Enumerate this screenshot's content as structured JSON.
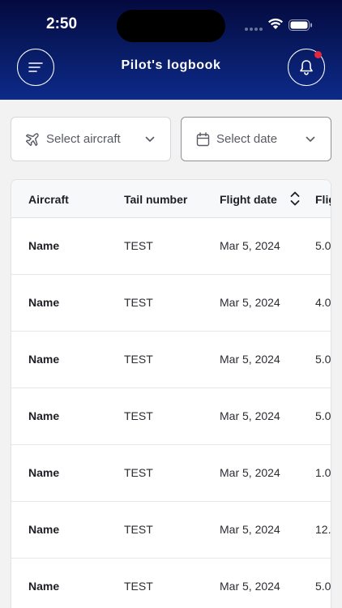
{
  "status_bar": {
    "time": "2:50"
  },
  "header": {
    "title": "Pilot's logbook"
  },
  "filters": {
    "aircraft": {
      "placeholder": "Select aircraft"
    },
    "date": {
      "placeholder": "Select date"
    }
  },
  "table": {
    "columns": [
      "Aircraft",
      "Tail number",
      "Flight date",
      "Flig"
    ],
    "rows": [
      {
        "aircraft": "Name",
        "tail": "TEST",
        "date": "Mar 5, 2024",
        "flight": "5.0"
      },
      {
        "aircraft": "Name",
        "tail": "TEST",
        "date": "Mar 5, 2024",
        "flight": "4.0"
      },
      {
        "aircraft": "Name",
        "tail": "TEST",
        "date": "Mar 5, 2024",
        "flight": "5.0"
      },
      {
        "aircraft": "Name",
        "tail": "TEST",
        "date": "Mar 5, 2024",
        "flight": "5.0"
      },
      {
        "aircraft": "Name",
        "tail": "TEST",
        "date": "Mar 5, 2024",
        "flight": "1.0"
      },
      {
        "aircraft": "Name",
        "tail": "TEST",
        "date": "Mar 5, 2024",
        "flight": "12."
      },
      {
        "aircraft": "Name",
        "tail": "TEST",
        "date": "Mar 5, 2024",
        "flight": "5.0"
      }
    ]
  },
  "colors": {
    "header_top": "#040a3f",
    "header_bottom": "#0d2a8a",
    "badge": "#e4283e"
  },
  "icons": [
    "menu-icon",
    "bell-icon",
    "plane-icon",
    "calendar-icon",
    "chevron-down-icon",
    "sort-icon",
    "wifi-icon",
    "battery-icon"
  ]
}
